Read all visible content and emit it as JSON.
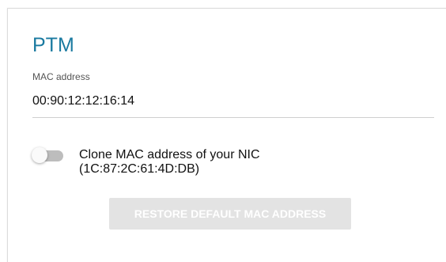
{
  "section": {
    "title": "PTM"
  },
  "mac_field": {
    "label": "MAC address",
    "value": "00:90:12:12:16:14"
  },
  "clone_toggle": {
    "label_line1": "Clone MAC address of your NIC",
    "label_line2": "(1C:87:2C:61:4D:DB)",
    "checked": false
  },
  "restore_button": {
    "label": "RESTORE DEFAULT MAC ADDRESS",
    "enabled": false
  },
  "colors": {
    "title": "#1a7aa0",
    "button_disabled_bg": "#e3e3e3",
    "toggle_track": "#bdbdbd"
  }
}
